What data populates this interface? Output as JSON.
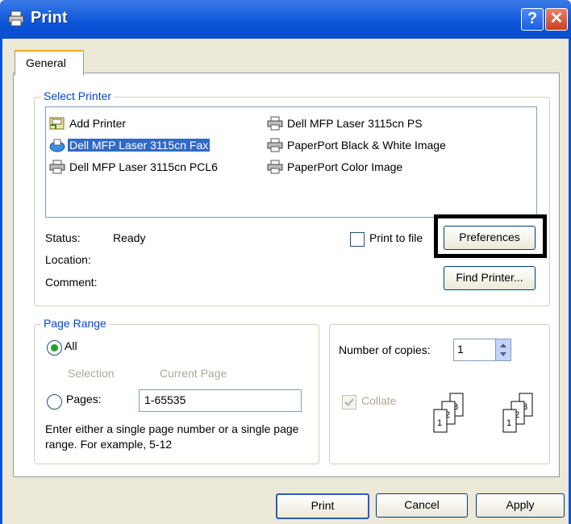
{
  "window": {
    "title": "Print",
    "help": "?",
    "close": "✕"
  },
  "tabs": [
    {
      "label": "General"
    }
  ],
  "select_printer": {
    "legend": "Select Printer",
    "printers": [
      {
        "label": "Add Printer",
        "icon": "add-printer-icon"
      },
      {
        "label": "Dell MFP Laser 3115cn Fax",
        "icon": "fax-icon",
        "selected": true
      },
      {
        "label": "Dell MFP Laser 3115cn PCL6",
        "icon": "printer-icon"
      },
      {
        "label": "Dell MFP Laser 3115cn PS",
        "icon": "printer-icon"
      },
      {
        "label": "PaperPort Black & White Image",
        "icon": "printer-icon"
      },
      {
        "label": "PaperPort Color Image",
        "icon": "printer-icon"
      }
    ],
    "status_label": "Status:",
    "status_value": "Ready",
    "location_label": "Location:",
    "comment_label": "Comment:",
    "print_to_file": "Print to file",
    "preferences": "Preferences",
    "find_printer": "Find Printer..."
  },
  "page_range": {
    "legend": "Page Range",
    "all": "All",
    "selection": "Selection",
    "current_page": "Current Page",
    "pages": "Pages:",
    "pages_value": "1-65535",
    "hint": "Enter either a single page number or a single page range. For example, 5-12"
  },
  "copies": {
    "label": "Number of copies:",
    "value": "1",
    "collate": "Collate",
    "collate_checked": true
  },
  "footer": {
    "print": "Print",
    "cancel": "Cancel",
    "apply": "Apply"
  },
  "colors": {
    "titlebar": "#0a54d8",
    "accent": "#0046d5",
    "selection": "#316ac5"
  }
}
